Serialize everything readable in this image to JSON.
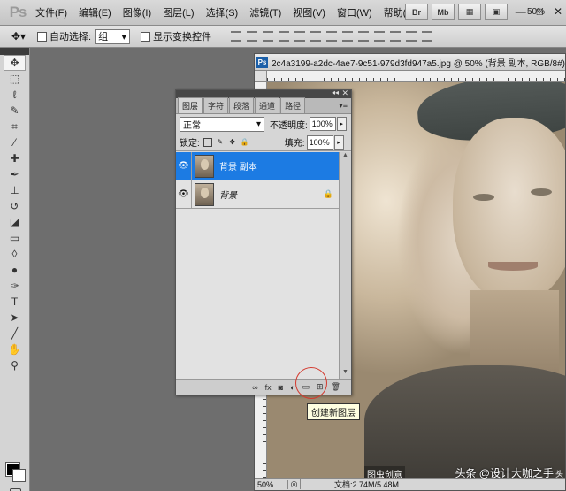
{
  "app": {
    "logo": "Ps",
    "zoom": "50%"
  },
  "menu": [
    "文件(F)",
    "编辑(E)",
    "图像(I)",
    "图层(L)",
    "选择(S)",
    "滤镜(T)",
    "视图(V)",
    "窗口(W)",
    "帮助(H)"
  ],
  "menu_buttons": [
    "Br",
    "Mb",
    "▦",
    "▣"
  ],
  "window_controls": [
    "—",
    "□",
    "✕"
  ],
  "options": {
    "auto_select_label": "自动选择:",
    "auto_select_value": "组",
    "show_transform_label": "显示变换控件"
  },
  "document": {
    "title": "2c4a3199-a2dc-4ae7-9c51-979d3fd947a5.jpg @ 50% (背景 副本, RGB/8#)",
    "status_zoom": "50%",
    "status_info": "文档:2.74M/5.48M",
    "watermark": "图虫创意",
    "watermark2": "头"
  },
  "layers_panel": {
    "tabs": [
      "图层",
      "字符",
      "段落",
      "通道",
      "路径"
    ],
    "blend_mode": "正常",
    "opacity_label": "不透明度:",
    "opacity_value": "100%",
    "lock_label": "锁定:",
    "fill_label": "填充:",
    "fill_value": "100%",
    "layers": [
      {
        "name": "背景 副本",
        "selected": true,
        "locked": false
      },
      {
        "name": "背景",
        "selected": false,
        "locked": true
      }
    ],
    "footer_icons": [
      "∞",
      "fx",
      "◙",
      "◐",
      "▭",
      "⊞",
      "🗑"
    ]
  },
  "tooltip": "创建新图层",
  "bottom_watermark": "头条 @设计大咖之手"
}
